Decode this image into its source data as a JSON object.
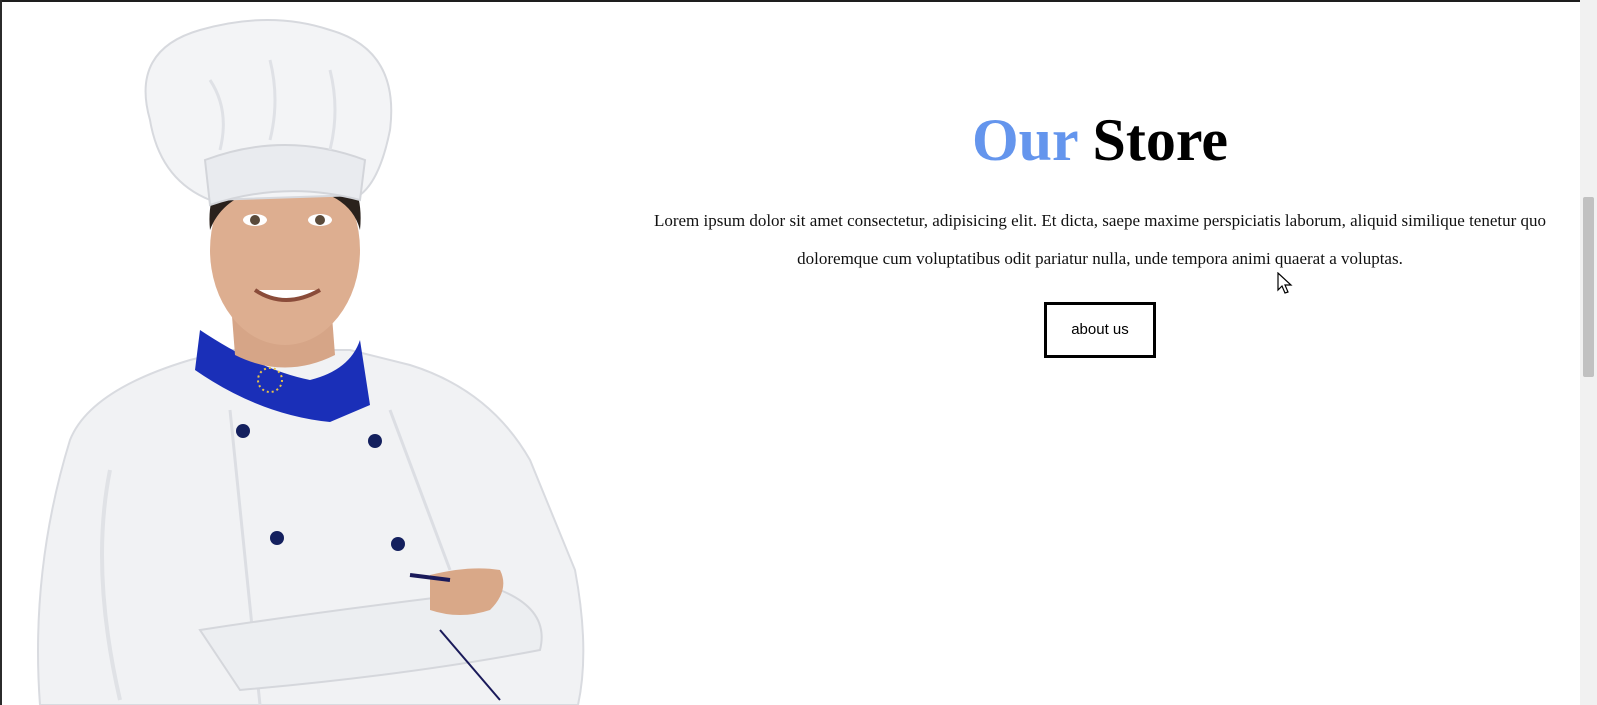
{
  "store": {
    "title_accent": "Our",
    "title_rest": "Store",
    "description": "Lorem ipsum dolor sit amet consectetur, adipisicing elit. Et dicta, saepe maxime perspiciatis laborum, aliquid similique tenetur quo doloremque cum voluptatibus odit pariatur nulla, unde tempora animi quaerat a voluptas.",
    "button_label": "about us"
  },
  "colors": {
    "accent": "#6495ED",
    "uniform_blue": "#1a2fb8",
    "background": "#ffffff"
  },
  "icons": {
    "cursor": "mouse-pointer-icon"
  }
}
